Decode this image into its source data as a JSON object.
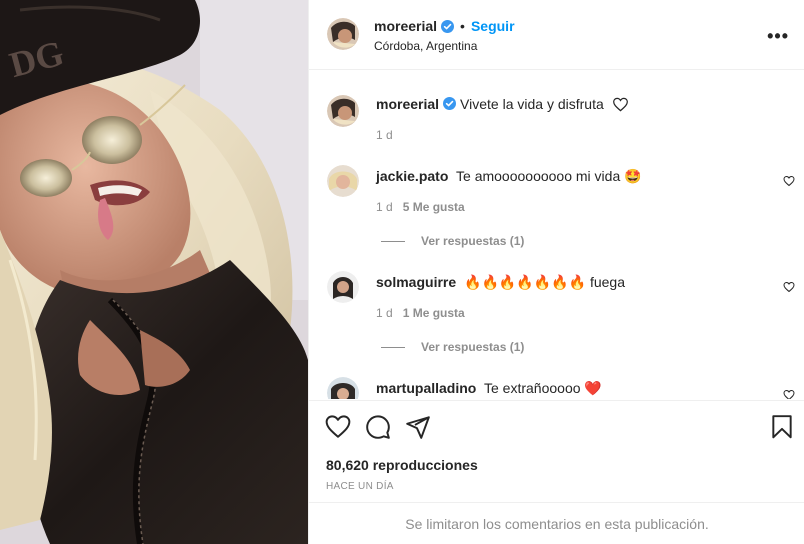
{
  "post": {
    "author": "moreerial",
    "verified": true,
    "separator": "•",
    "follow_label": "Seguir",
    "location": "Córdoba, Argentina",
    "more_icon": "more-options-icon",
    "more_label": "•••"
  },
  "caption": {
    "username": "moreerial",
    "text": "Vivete la vida y disfruta",
    "time": "1 d"
  },
  "comments": [
    {
      "username": "jackie.pato",
      "text": "Te amoooooooooo mi vida 🤩",
      "time": "1 d",
      "likes": "5 Me gusta",
      "replies": "Ver respuestas (1)"
    },
    {
      "username": "solmaguirre",
      "text": "🔥🔥🔥🔥🔥🔥🔥 fuega",
      "time": "1 d",
      "likes": "1 Me gusta",
      "replies": "Ver respuestas (1)"
    },
    {
      "username": "martupalladino",
      "text": "Te extrañooooo ❤️"
    }
  ],
  "stats": {
    "views": "80,620 reproducciones",
    "time_ago": "HACE UN DÍA"
  },
  "footer": {
    "limited": "Se limitaron los comentarios en esta publicación."
  },
  "colors": {
    "accent": "#0095f6",
    "text": "#262626",
    "muted": "#8e8e8e",
    "border": "#efefef"
  }
}
